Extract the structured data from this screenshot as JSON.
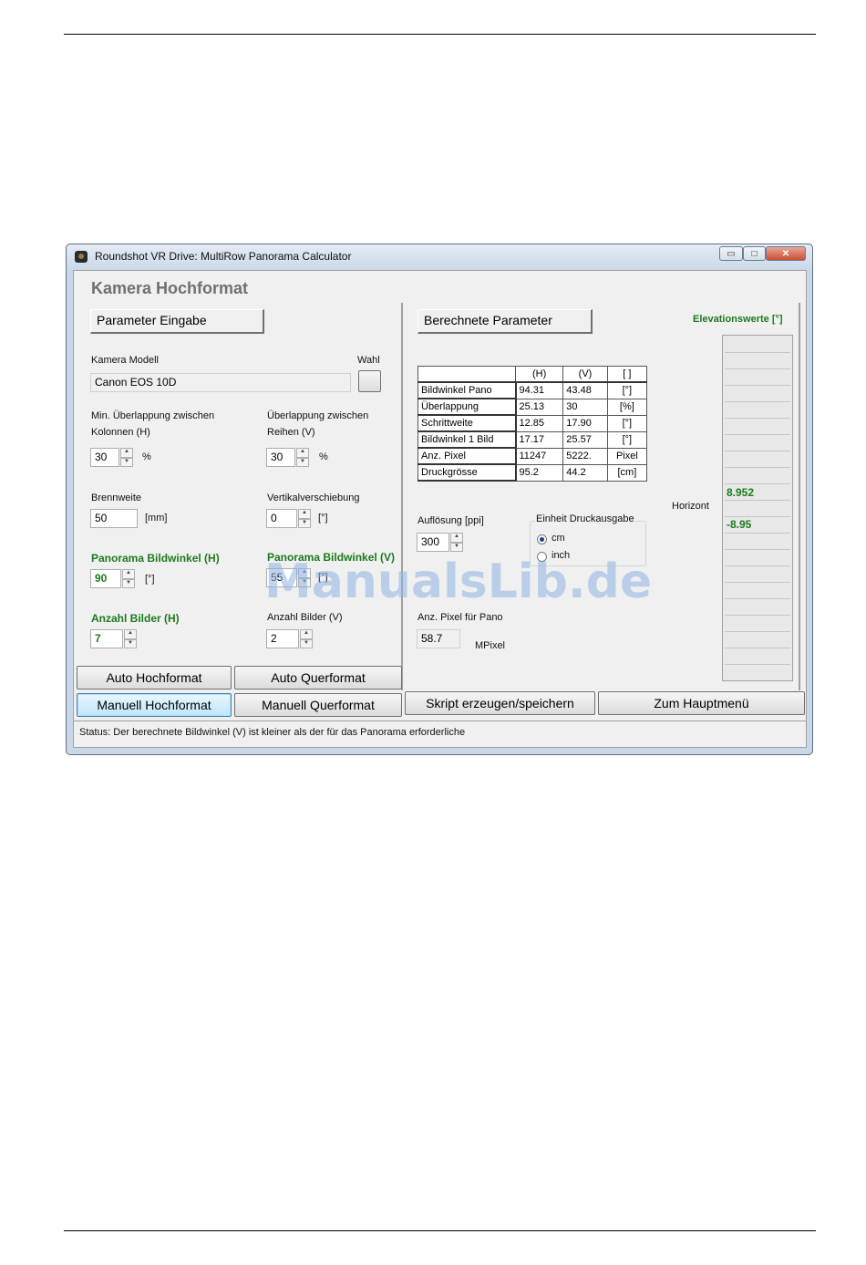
{
  "window": {
    "title": "Roundshot VR Drive:   MultiRow Panorama Calculator",
    "heading": "Kamera Hochformat",
    "controls": {
      "minimize": "▭",
      "maximize": "□",
      "close": "✕"
    }
  },
  "left": {
    "section_button": "Parameter Eingabe",
    "camera_model_label": "Kamera Modell",
    "camera_model_value": "Canon EOS 10D",
    "wahl_label": "Wahl",
    "overlap_cols_label_1": "Min. Überlappung zwischen",
    "overlap_cols_label_2": "Kolonnen (H)",
    "overlap_cols_value": "30",
    "overlap_cols_unit": "%",
    "overlap_rows_label_1": "Überlappung zwischen",
    "overlap_rows_label_2": "Reihen (V)",
    "overlap_rows_value": "30",
    "overlap_rows_unit": "%",
    "focal_label": "Brennweite",
    "focal_value": "50",
    "focal_unit": "[mm]",
    "vshift_label": "Vertikalverschiebung",
    "vshift_value": "0",
    "vshift_unit": "[°]",
    "pano_angle_h_label": "Panorama Bildwinkel (H)",
    "pano_angle_h_value": "90",
    "pano_angle_h_unit": "[°]",
    "pano_angle_v_label": "Panorama Bildwinkel (V)",
    "pano_angle_v_value": "55",
    "pano_angle_v_unit": "[°]",
    "count_h_label": "Anzahl Bilder (H)",
    "count_h_value": "7",
    "count_v_label": "Anzahl Bilder (V)",
    "count_v_value": "2"
  },
  "right": {
    "section_button": "Berechnete Parameter",
    "table": {
      "headers": [
        "",
        "(H)",
        "(V)",
        "[ ]"
      ],
      "rows": [
        [
          "Bildwinkel Pano",
          "94.31",
          "43.48",
          "[°]"
        ],
        [
          "Überlappung",
          "25.13",
          "30",
          "[%]"
        ],
        [
          "Schrittweite",
          "12.85",
          "17.90",
          "[°]"
        ],
        [
          "Bildwinkel 1 Bild",
          "17.17",
          "25.57",
          "[°]"
        ],
        [
          "Anz. Pixel",
          "11247",
          "5222.",
          "Pixel"
        ],
        [
          "Druckgrösse",
          "95.2",
          "44.2",
          "[cm]"
        ]
      ]
    },
    "resolution_label": "Auflösung [ppi]",
    "resolution_value": "300",
    "unit_group_label": "Einheit Druckausgabe",
    "unit_cm": "cm",
    "unit_inch": "inch",
    "pixels_label": "Anz. Pixel für Pano",
    "pixels_value": "58.7",
    "pixels_unit": "MPixel",
    "elevation_title": "Elevationswerte [°]",
    "horizon_label": "Horizont",
    "elevation_upper": "8.952",
    "elevation_lower": "-8.95"
  },
  "buttons": {
    "auto_portrait": "Auto Hochformat",
    "auto_landscape": "Auto Querformat",
    "manual_portrait": "Manuell Hochformat",
    "manual_landscape": "Manuell Querformat",
    "script": "Skript erzeugen/speichern",
    "main_menu": "Zum Hauptmenü"
  },
  "status": "Status: Der berechnete Bildwinkel (V) ist kleiner als der für das Panorama erforderliche",
  "watermark": "ManualsLib.de"
}
